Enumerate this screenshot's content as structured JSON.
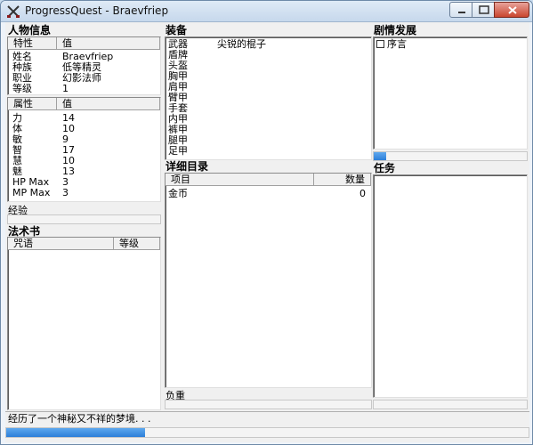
{
  "window": {
    "title": "ProgressQuest - Braevfriep"
  },
  "character": {
    "section_title": "人物信息",
    "headers": [
      "特性",
      "值"
    ],
    "rows": [
      {
        "k": "姓名",
        "v": "Braevfriep"
      },
      {
        "k": "种族",
        "v": "低等精灵"
      },
      {
        "k": "职业",
        "v": "幻影法师"
      },
      {
        "k": "等级",
        "v": "1"
      }
    ]
  },
  "stats": {
    "headers": [
      "属性",
      "值"
    ],
    "rows": [
      {
        "k": "力",
        "v": "14"
      },
      {
        "k": "体",
        "v": "10"
      },
      {
        "k": "敏",
        "v": "9"
      },
      {
        "k": "智",
        "v": "17"
      },
      {
        "k": "慧",
        "v": "10"
      },
      {
        "k": "魅",
        "v": "13"
      },
      {
        "k": "HP Max",
        "v": "3"
      },
      {
        "k": "MP Max",
        "v": "3"
      }
    ]
  },
  "experience": {
    "label": "经验",
    "progress": 0
  },
  "spellbook": {
    "section_title": "法术书",
    "headers": [
      "咒语",
      "等级"
    ]
  },
  "equipment": {
    "section_title": "装备",
    "slots": [
      {
        "slot": "武器",
        "item": "尖锐的棍子"
      },
      {
        "slot": "盾牌",
        "item": ""
      },
      {
        "slot": "头盔",
        "item": ""
      },
      {
        "slot": "胸甲",
        "item": ""
      },
      {
        "slot": "肩甲",
        "item": ""
      },
      {
        "slot": "臂甲",
        "item": ""
      },
      {
        "slot": "手套",
        "item": ""
      },
      {
        "slot": "内甲",
        "item": ""
      },
      {
        "slot": "裤甲",
        "item": ""
      },
      {
        "slot": "腿甲",
        "item": ""
      },
      {
        "slot": "足甲",
        "item": ""
      }
    ]
  },
  "inventory": {
    "section_title": "详细目录",
    "headers": [
      "项目",
      "数量"
    ],
    "rows": [
      {
        "item": "金币",
        "qty": "0"
      }
    ],
    "encumbrance_label": "负重",
    "encumbrance_progress": 0
  },
  "plot": {
    "section_title": "剧情发展",
    "items": [
      {
        "label": "序言",
        "checked": false
      }
    ],
    "progress": 0.08
  },
  "quests": {
    "section_title": "任务",
    "progress": 0
  },
  "status": {
    "text": "经历了一个神秘又不祥的梦境. . .",
    "progress": 0.265
  },
  "colors": {
    "accent_bar": "#2d7fd9"
  },
  "icons": {
    "app": "sword-crossed-icon",
    "min": "minimize-icon",
    "max": "maximize-icon",
    "close": "close-icon"
  }
}
